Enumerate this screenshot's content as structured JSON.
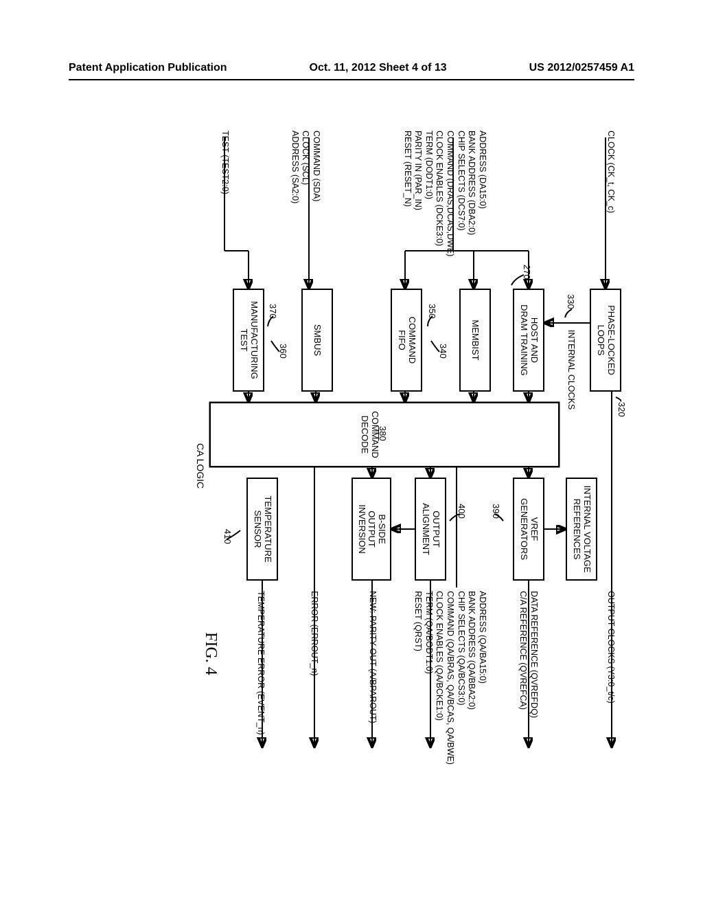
{
  "header": {
    "left": "Patent Application Publication",
    "center": "Oct. 11, 2012  Sheet 4 of 13",
    "right": "US 2012/0257459 A1"
  },
  "figure_label": "FIG. 4",
  "inputs": {
    "clock": "CLOCK (CK_t, CK_c)",
    "ca_group": "ADDRESS (DA15:0)\nBANK ADDRESS (DBA2:0)\nCHIP SELECTS (DCS7:0)\nCOMMAND (DRAS,DCAS,DWE)\nCLOCK ENABLES (DCKE3:0)\nTERM (DODT1:0)\nPARITY IN (PAR_IN)\nRESET (RESET_N)",
    "smbus_group": "COMMAND (SDA)\nCLOCK (SCL)\nADDRESS (SA2:0)",
    "test": "TEST (TEST2:0)"
  },
  "blocks": {
    "pll": "PHASE-LOCKED\nLOOPS",
    "host": "HOST AND\nDRAM TRAINING",
    "membist": "MEMBIST",
    "cmdfifo": "COMMAND\nFIFO",
    "smbus": "SMBUS",
    "mfgtest": "MANUFACTURING\nTEST",
    "cmddecode": "COMMAND\nDECODE",
    "ivr": "INTERNAL VOLTAGE\nREFERENCES",
    "vrefgen": "VREF\nGENERATORS",
    "outalign": "OUTPUT\nALIGNMENT",
    "bside": "B-SIDE\nOUTPUT\nINVERSION",
    "tempsensor": "TEMPERATURE\nSENSOR"
  },
  "refs": {
    "r270": "270",
    "r320": "320",
    "r330": "330",
    "r340": "340",
    "r350": "350",
    "r360": "360",
    "r370": "370",
    "r380": "380",
    "r390": "390",
    "r400": "400",
    "r410": "410",
    "internal_clocks": "INTERNAL CLOCKS"
  },
  "outputs": {
    "outclocks": "OUTPUT CLOCKS (Y3:0_t/c)",
    "vref_out": "DATA REFERENCE (QVREFDQ)\nC/A REFERENCE (QVREFCA)",
    "ca_out": "ADDRESS (QA/BA15:0)\nBANK ADDRESS (QA/BBA2:0)\nCHIP SELECTS (QA/BCS3:0)\nCOMMAND (QA/BRAS, QA/BCAS, QA/BWE)\nCLOCK ENABLES (QA/BCKE1:0)\nTERM (QA/BODT1:0)\nRESET (QRST)",
    "parity_out": "NEW: PARITY OUT (A/BPAROUT)",
    "error_out": "ERROR (ERROUT_n)",
    "temp_err": "TEMPERATURE ERROR (EVENT_n)"
  },
  "calogic": "CA LOGIC",
  "decode_num": "380"
}
